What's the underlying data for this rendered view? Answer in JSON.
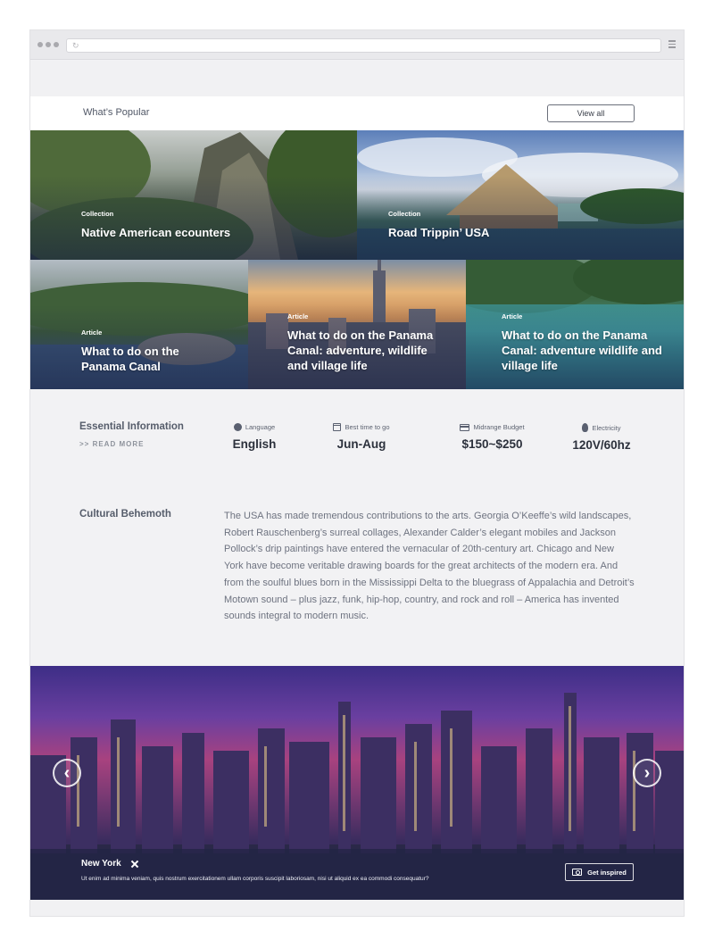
{
  "popular": {
    "title": "What’s Popular",
    "view_all": "View all"
  },
  "tiles": [
    {
      "kind": "Collection",
      "title": "Native American ecounters"
    },
    {
      "kind": "Collection",
      "title": "Road Trippin’ USA"
    },
    {
      "kind": "Article",
      "title": "What to do on the Panama Canal"
    },
    {
      "kind": "Article",
      "title": "What to do on the Panama Canal: adventure, wildlife and village life"
    },
    {
      "kind": "Article",
      "title": "What to do on the Panama Canal: adventure wildlife and village life"
    }
  ],
  "essential": {
    "title": "Essential Information",
    "read_more": ">> READ MORE",
    "items": [
      {
        "label": "Language",
        "value": "English",
        "icon": "globe-icon"
      },
      {
        "label": "Best time to go",
        "value": "Jun-Aug",
        "icon": "calendar-icon"
      },
      {
        "label": "Midrange Budget",
        "value": "$150~$250",
        "icon": "credit-card-icon"
      },
      {
        "label": "Electricity",
        "value": "120V/60hz",
        "icon": "lightbulb-icon"
      }
    ]
  },
  "cultural": {
    "title": "Cultural Behemoth",
    "body": "The USA has made tremendous contributions to the arts. Georgia O’Keeffe’s wild landscapes, Robert Rauschenberg’s surreal collages, Alexander Calder’s elegant mobiles and Jackson Pollock’s drip paintings have entered the vernacular of 20th-century art. Chicago and New York have become veritable drawing boards for the great architects of the modern era. And from the soulful blues born in the Mississippi Delta to the bluegrass of Appalachia and Detroit’s Motown sound – plus jazz, funk, hip-hop, country, and rock and roll – America has invented sounds integral to modern music."
  },
  "hero": {
    "title": "New York",
    "text": "Ut enim ad minima veniam, quis nostrum exercitationem ullam corporis suscipit laboriosam, nisi ut aliquid ex ea commodi consequatur?",
    "button": "Get inspired",
    "prev": "‹",
    "next": "›"
  }
}
